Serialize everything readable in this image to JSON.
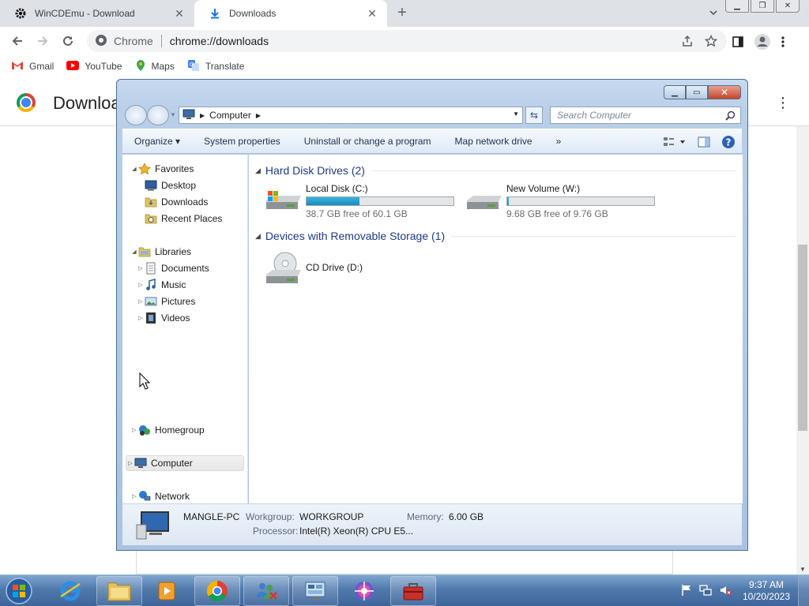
{
  "browser": {
    "tabs": [
      {
        "title": "WinCDEmu - Download",
        "close": "✕"
      },
      {
        "title": "Downloads",
        "close": "✕"
      }
    ],
    "new_tab": "+",
    "omnibox": {
      "scheme": "Chrome",
      "url": "chrome://downloads"
    },
    "bookmarks": [
      {
        "label": "Gmail",
        "icon": "gmail-icon"
      },
      {
        "label": "YouTube",
        "icon": "youtube-icon"
      },
      {
        "label": "Maps",
        "icon": "maps-icon"
      },
      {
        "label": "Translate",
        "icon": "translate-icon"
      }
    ],
    "page_title": "Download"
  },
  "explorer": {
    "address": {
      "segment": "Computer"
    },
    "search_placeholder": "Search Computer",
    "commands": [
      "Organize",
      "System properties",
      "Uninstall or change a program",
      "Map network drive",
      "»"
    ],
    "nav": {
      "favorites": "Favorites",
      "favorites_items": [
        "Desktop",
        "Downloads",
        "Recent Places"
      ],
      "libraries": "Libraries",
      "libraries_items": [
        "Documents",
        "Music",
        "Pictures",
        "Videos"
      ],
      "homegroup": "Homegroup",
      "computer": "Computer",
      "network": "Network"
    },
    "groups": {
      "hdd": "Hard Disk Drives (2)",
      "removable": "Devices with Removable Storage (1)"
    },
    "drives": [
      {
        "name": "Local Disk (C:)",
        "free": "38.7 GB free of 60.1 GB",
        "used_fraction": 0.36
      },
      {
        "name": "New Volume (W:)",
        "free": "9.68 GB free of 9.76 GB",
        "used_fraction": 0.01
      }
    ],
    "cd_drive": "CD Drive (D:)",
    "details": {
      "pc_name": "MANGLE-PC",
      "workgroup_label": "Workgroup:",
      "workgroup": "WORKGROUP",
      "memory_label": "Memory:",
      "memory": "6.00 GB",
      "processor_label": "Processor:",
      "processor": "Intel(R) Xeon(R) CPU E5..."
    }
  },
  "taskbar": {
    "time": "9:37 AM",
    "date": "10/20/2023"
  },
  "colors": {
    "drive_bar": "#1a8bb8",
    "taskbar": "#4f77a9",
    "group_header": "#1e3a8a"
  }
}
